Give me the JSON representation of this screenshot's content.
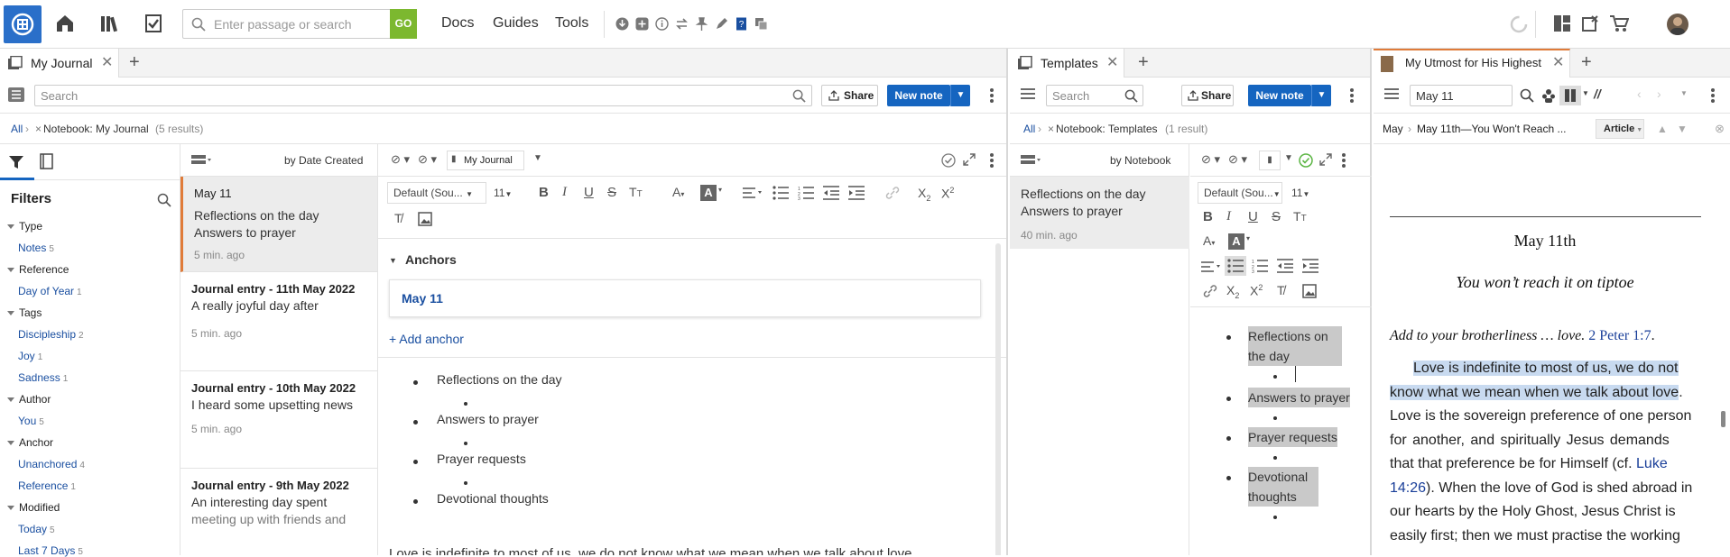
{
  "topbar": {
    "search_placeholder": "Enter passage or search",
    "go_label": "GO",
    "nav": [
      "Docs",
      "Guides",
      "Tools"
    ]
  },
  "journal": {
    "tab_label": "My Journal",
    "search_placeholder": "Search",
    "share_label": "Share",
    "new_note_label": "New note",
    "crumb_all": "All",
    "crumb_notebook": "Notebook: My Journal",
    "crumb_count": "(5 results)",
    "filters_title": "Filters",
    "filters": [
      {
        "label": "Type",
        "items": [
          {
            "name": "Notes",
            "count": "5"
          }
        ]
      },
      {
        "label": "Reference",
        "items": [
          {
            "name": "Day of Year",
            "count": "1"
          }
        ]
      },
      {
        "label": "Tags",
        "items": [
          {
            "name": "Discipleship",
            "count": "2"
          },
          {
            "name": "Joy",
            "count": "1"
          },
          {
            "name": "Sadness",
            "count": "1"
          }
        ]
      },
      {
        "label": "Author",
        "items": [
          {
            "name": "You",
            "count": "5"
          }
        ]
      },
      {
        "label": "Anchor",
        "items": [
          {
            "name": "Unanchored",
            "count": "4"
          },
          {
            "name": "Reference",
            "count": "1"
          }
        ]
      },
      {
        "label": "Modified",
        "items": [
          {
            "name": "Today",
            "count": "5"
          },
          {
            "name": "Last 7 Days",
            "count": "5"
          }
        ]
      }
    ],
    "sort_label": "by Date Created",
    "notes": [
      {
        "title": "May 11",
        "lines": [
          "Reflections on the day",
          "Answers to prayer"
        ],
        "time": "5 min. ago"
      },
      {
        "title": "Journal entry - 11th May 2022",
        "lines": [
          "A really joyful day after"
        ],
        "time": "5 min. ago"
      },
      {
        "title": "Journal entry - 10th May 2022",
        "lines": [
          "I heard some upsetting news"
        ],
        "time": "5 min. ago"
      },
      {
        "title": "Journal entry - 9th May 2022",
        "lines": [
          "An interesting day spent",
          "meeting up with friends and"
        ],
        "time": ""
      }
    ],
    "editor": {
      "notebook_label": "My Journal",
      "font_label": "Default (Sou...",
      "size_label": "11",
      "anchors_label": "Anchors",
      "anchor_value": "May 11",
      "add_anchor": "+ Add anchor",
      "bullets": [
        "Reflections on the day",
        "Answers to prayer",
        "Prayer requests",
        "Devotional thoughts"
      ],
      "bottom_text": "Love is indefinite to most of us, we do not know what we mean when we talk about love"
    }
  },
  "templates": {
    "tab_label": "Templates",
    "search_placeholder": "Search",
    "share_label": "Share",
    "new_note_label": "New note",
    "crumb_all": "All",
    "crumb_notebook": "Notebook: Templates",
    "crumb_count": "(1 result)",
    "sort_label": "by Notebook",
    "note": {
      "lines": [
        "Reflections on the day",
        "Answers to prayer"
      ],
      "time": "40 min. ago"
    },
    "font_label": "Default (Sou...",
    "size_label": "11",
    "bullets": [
      "Reflections on the day",
      "Answers to prayer",
      "Prayer requests",
      "Devotional thoughts"
    ]
  },
  "reader": {
    "tab_label": "My Utmost for His Highest",
    "search_value": "May 11",
    "crumb_1": "May",
    "crumb_2": "May 11th—You Won't Reach ...",
    "view_label": "Article",
    "heading": "May 11th",
    "subheading": "You won’t reach it on tiptoe",
    "verse_intro": "Add to your brotherliness … love.",
    "verse_ref": "2 Peter 1:7",
    "para": {
      "hl1": "Love is indefinite to most of us, we do not",
      "hl2": "know what we mean when we talk about love",
      "l3": "Love is the sovereign preference of one person",
      "l4": "for another, and spiritually Jesus demands",
      "l5a": "that that preference be for Himself (cf.",
      "l5ref": "Luke",
      "l6ref": "14:26",
      "l6b": "). When the love of God is shed abroad in",
      "l7": "our hearts by the Holy Ghost, Jesus Christ is",
      "l8": "easily first; then we must practise the working"
    }
  }
}
